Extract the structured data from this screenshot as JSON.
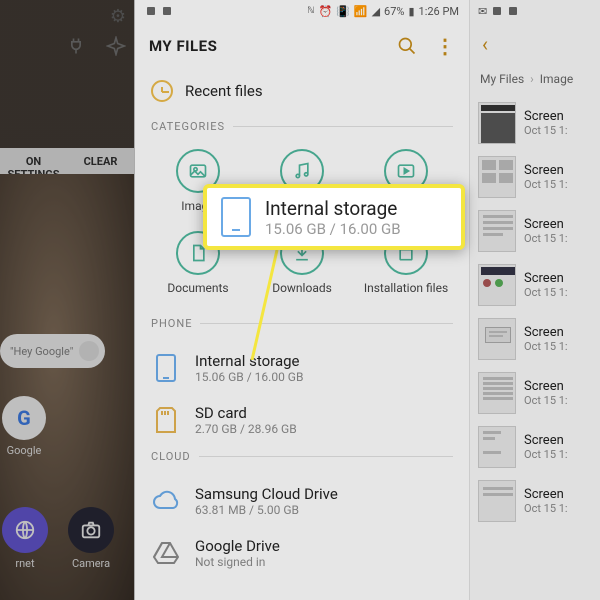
{
  "status_bar": {
    "battery_text": "67%",
    "time": "1:26 PM"
  },
  "left": {
    "btn_settings": "ON SETTINGS",
    "btn_clear": "CLEAR",
    "search_placeholder": "\"Hey Google\"",
    "app_google": "Google",
    "dock_internet": "rnet",
    "dock_camera": "Camera"
  },
  "mid": {
    "title": "MY FILES",
    "recent": "Recent files",
    "sec_categories": "CATEGORIES",
    "cats": [
      {
        "label": "Image"
      },
      {
        "label": ""
      },
      {
        "label": ""
      },
      {
        "label": "Documents"
      },
      {
        "label": "Downloads"
      },
      {
        "label": "Installation files"
      }
    ],
    "sec_phone": "PHONE",
    "phone": [
      {
        "title": "Internal storage",
        "sub": "15.06 GB / 16.00 GB"
      },
      {
        "title": "SD card",
        "sub": "2.70 GB / 28.96 GB"
      }
    ],
    "sec_cloud": "CLOUD",
    "cloud": [
      {
        "title": "Samsung Cloud Drive",
        "sub": "63.81 MB / 5.00 GB"
      },
      {
        "title": "Google Drive",
        "sub": "Not signed in"
      }
    ]
  },
  "callout": {
    "title": "Internal storage",
    "sub": "15.06 GB / 16.00 GB"
  },
  "right": {
    "crumb_root": "My Files",
    "crumb_leaf": "Image",
    "files": [
      {
        "name": "Screen",
        "date": "Oct 15 1:"
      },
      {
        "name": "Screen",
        "date": "Oct 15 1:"
      },
      {
        "name": "Screen",
        "date": "Oct 15 1:"
      },
      {
        "name": "Screen",
        "date": "Oct 15 1:"
      },
      {
        "name": "Screen",
        "date": "Oct 15 1:"
      },
      {
        "name": "Screen",
        "date": "Oct 15 1:"
      },
      {
        "name": "Screen",
        "date": "Oct 15 1:"
      },
      {
        "name": "Screen",
        "date": "Oct 15 1:"
      }
    ]
  }
}
